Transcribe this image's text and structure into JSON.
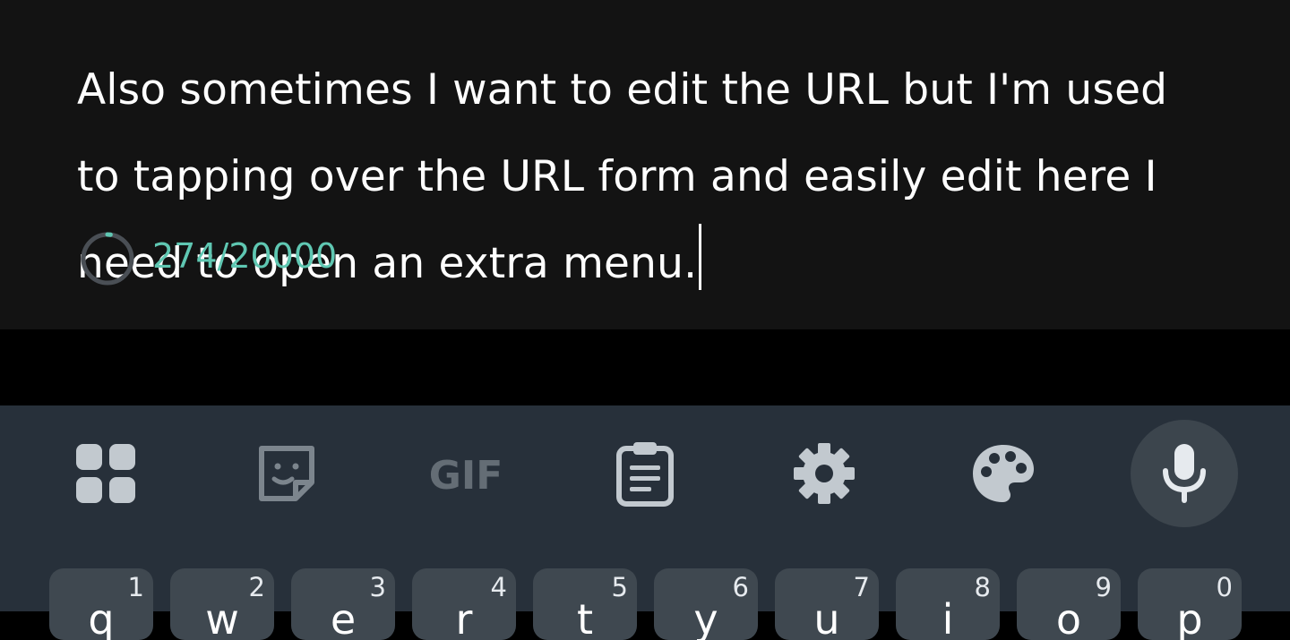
{
  "compose": {
    "text": "Also sometimes I want to edit the URL but I'm used to tapping over the URL form and easily edit here I need to open an extra menu.",
    "counter": "274/20000",
    "counter_fraction": 0.0137,
    "counter_color": "#5fc7b2"
  },
  "keyboard": {
    "background": "#27303a",
    "toolbar": [
      {
        "name": "apps-grid-icon"
      },
      {
        "name": "sticker-icon"
      },
      {
        "name": "gif-icon",
        "label": "GIF"
      },
      {
        "name": "clipboard-icon"
      },
      {
        "name": "settings-gear-icon"
      },
      {
        "name": "theme-palette-icon"
      },
      {
        "name": "microphone-icon"
      }
    ],
    "row1": [
      {
        "hint": "1",
        "letter": "q"
      },
      {
        "hint": "2",
        "letter": "w"
      },
      {
        "hint": "3",
        "letter": "e"
      },
      {
        "hint": "4",
        "letter": "r"
      },
      {
        "hint": "5",
        "letter": "t"
      },
      {
        "hint": "6",
        "letter": "y"
      },
      {
        "hint": "7",
        "letter": "u"
      },
      {
        "hint": "8",
        "letter": "i"
      },
      {
        "hint": "9",
        "letter": "o"
      },
      {
        "hint": "0",
        "letter": "p"
      }
    ]
  }
}
